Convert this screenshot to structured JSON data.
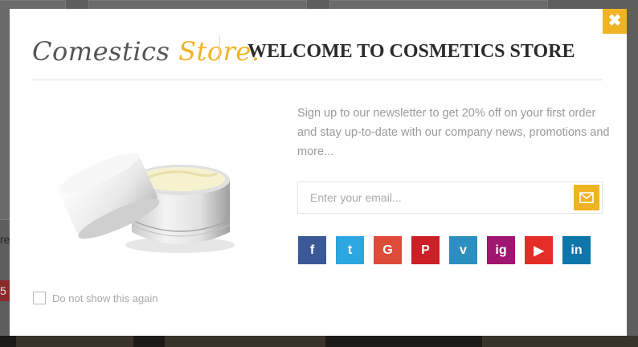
{
  "background": {
    "text_fragment": "re",
    "tag_text": "5"
  },
  "modal": {
    "logo": {
      "part1": "Comestics",
      "part2": "Store."
    },
    "title": "WELCOME TO COSMETICS STORE",
    "description": "Sign up to our newsletter to get 20% off on your first order and stay up-to-date with our company news, promotions and more...",
    "email_placeholder": "Enter your email...",
    "dont_show_label": "Do not show this again",
    "colors": {
      "accent": "#f0b323"
    },
    "social": [
      {
        "name": "facebook",
        "glyph": "f",
        "color": "#3b5998"
      },
      {
        "name": "twitter",
        "glyph": "t",
        "color": "#2ca7e0"
      },
      {
        "name": "google",
        "glyph": "G",
        "color": "#dd4b39"
      },
      {
        "name": "pinterest",
        "glyph": "P",
        "color": "#cb2027"
      },
      {
        "name": "vimeo",
        "glyph": "v",
        "color": "#2d8fc0"
      },
      {
        "name": "instagram",
        "glyph": "ig",
        "color": "#a0156f"
      },
      {
        "name": "youtube",
        "glyph": "▶",
        "color": "#e52d27"
      },
      {
        "name": "linkedin",
        "glyph": "in",
        "color": "#0e76a8"
      }
    ]
  }
}
